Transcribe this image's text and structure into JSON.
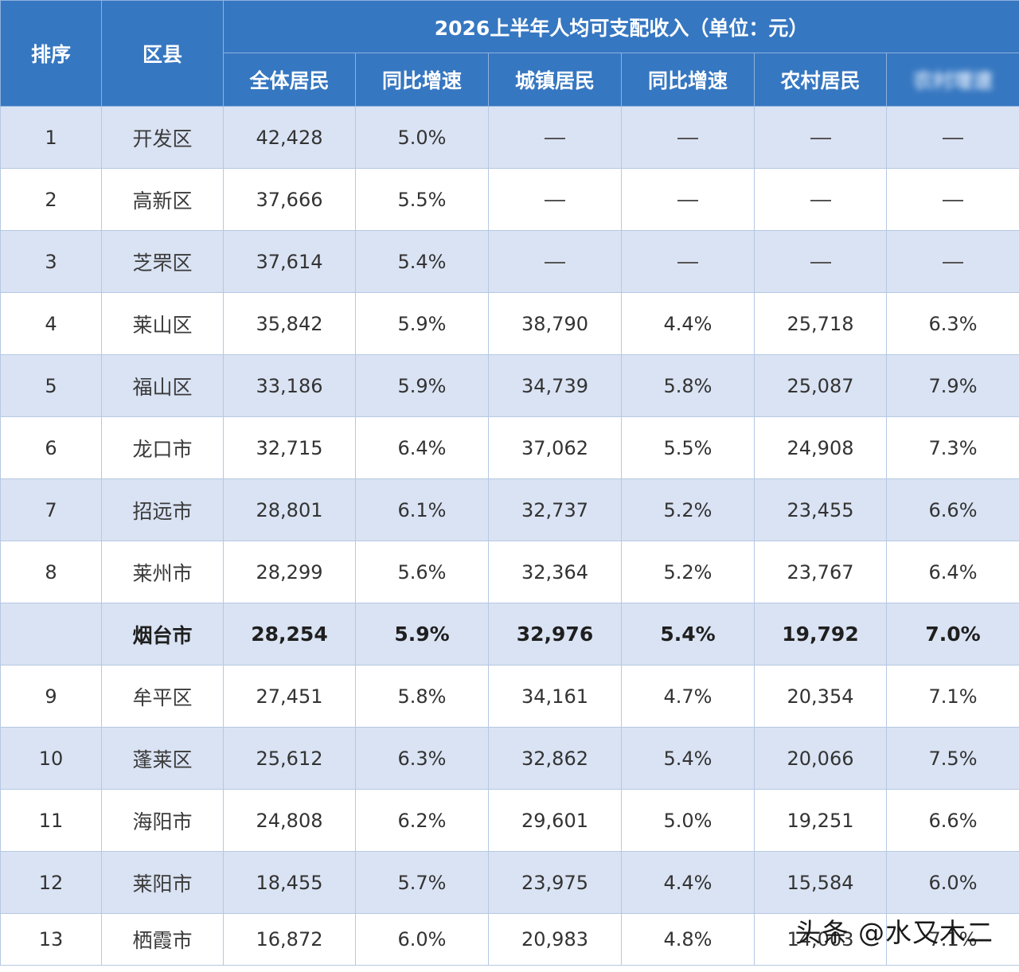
{
  "chart_data": {
    "type": "table",
    "title": "2026上半年人均可支配收入（单位：元）",
    "header": {
      "rank": "排序",
      "district": "区县",
      "columns": [
        "全体居民",
        "同比增速",
        "城镇居民",
        "同比增速",
        "农村居民",
        "农村增速"
      ]
    },
    "rows": [
      {
        "rank": "1",
        "name": "开发区",
        "all": "42,428",
        "all_growth": "5.0%",
        "urban": "—",
        "urban_growth": "—",
        "rural": "—",
        "rural_growth": "—"
      },
      {
        "rank": "2",
        "name": "高新区",
        "all": "37,666",
        "all_growth": "5.5%",
        "urban": "—",
        "urban_growth": "—",
        "rural": "—",
        "rural_growth": "—"
      },
      {
        "rank": "3",
        "name": "芝罘区",
        "all": "37,614",
        "all_growth": "5.4%",
        "urban": "—",
        "urban_growth": "—",
        "rural": "—",
        "rural_growth": "—"
      },
      {
        "rank": "4",
        "name": "莱山区",
        "all": "35,842",
        "all_growth": "5.9%",
        "urban": "38,790",
        "urban_growth": "4.4%",
        "rural": "25,718",
        "rural_growth": "6.3%"
      },
      {
        "rank": "5",
        "name": "福山区",
        "all": "33,186",
        "all_growth": "5.9%",
        "urban": "34,739",
        "urban_growth": "5.8%",
        "rural": "25,087",
        "rural_growth": "7.9%"
      },
      {
        "rank": "6",
        "name": "龙口市",
        "all": "32,715",
        "all_growth": "6.4%",
        "urban": "37,062",
        "urban_growth": "5.5%",
        "rural": "24,908",
        "rural_growth": "7.3%"
      },
      {
        "rank": "7",
        "name": "招远市",
        "all": "28,801",
        "all_growth": "6.1%",
        "urban": "32,737",
        "urban_growth": "5.2%",
        "rural": "23,455",
        "rural_growth": "6.6%"
      },
      {
        "rank": "8",
        "name": "莱州市",
        "all": "28,299",
        "all_growth": "5.6%",
        "urban": "32,364",
        "urban_growth": "5.2%",
        "rural": "23,767",
        "rural_growth": "6.4%"
      },
      {
        "rank": "",
        "name": "烟台市",
        "all": "28,254",
        "all_growth": "5.9%",
        "urban": "32,976",
        "urban_growth": "5.4%",
        "rural": "19,792",
        "rural_growth": "7.0%",
        "total": true
      },
      {
        "rank": "9",
        "name": "牟平区",
        "all": "27,451",
        "all_growth": "5.8%",
        "urban": "34,161",
        "urban_growth": "4.7%",
        "rural": "20,354",
        "rural_growth": "7.1%"
      },
      {
        "rank": "10",
        "name": "蓬莱区",
        "all": "25,612",
        "all_growth": "6.3%",
        "urban": "32,862",
        "urban_growth": "5.4%",
        "rural": "20,066",
        "rural_growth": "7.5%"
      },
      {
        "rank": "11",
        "name": "海阳市",
        "all": "24,808",
        "all_growth": "6.2%",
        "urban": "29,601",
        "urban_growth": "5.0%",
        "rural": "19,251",
        "rural_growth": "6.6%"
      },
      {
        "rank": "12",
        "name": "莱阳市",
        "all": "18,455",
        "all_growth": "5.7%",
        "urban": "23,975",
        "urban_growth": "4.4%",
        "rural": "15,584",
        "rural_growth": "6.0%"
      },
      {
        "rank": "13",
        "name": "栖霞市",
        "all": "16,872",
        "all_growth": "6.0%",
        "urban": "20,983",
        "urban_growth": "4.8%",
        "rural": "14,003",
        "rural_growth": "7.1%"
      }
    ]
  },
  "watermark": "头条 @水又木二",
  "colors": {
    "header_bg": "#3677c1",
    "stripe_bg": "#dae3f3"
  }
}
